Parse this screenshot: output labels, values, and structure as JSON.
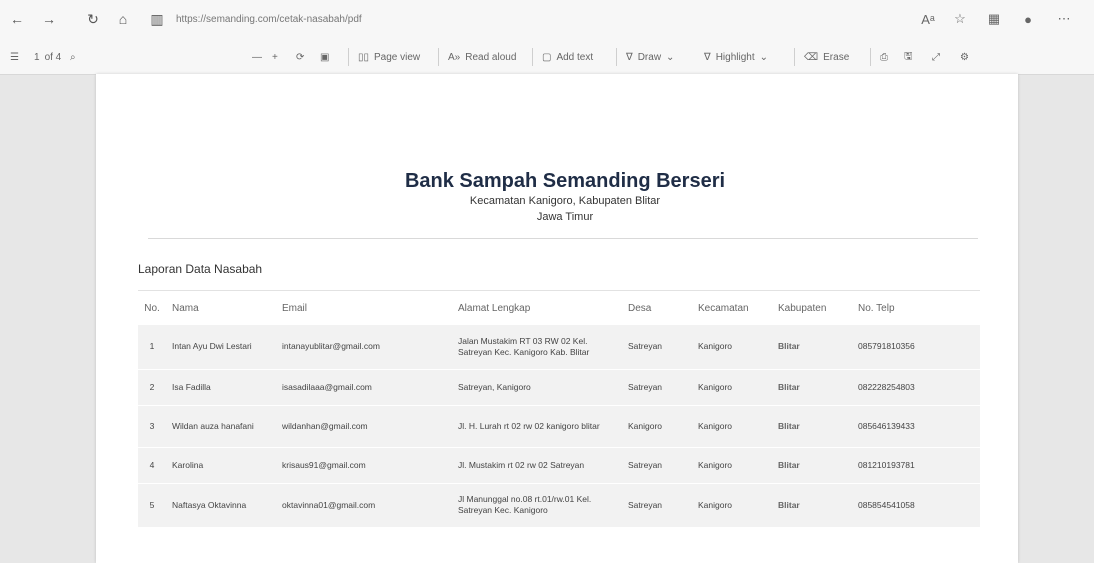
{
  "browser": {
    "url": "https://semanding.com/cetak-nasabah/pdf",
    "icons": [
      "back-icon",
      "forward-icon",
      "refresh-icon",
      "home-icon",
      "site-info-icon",
      "read-aloud-icon",
      "favorite-icon",
      "collections-icon",
      "profile-icon",
      "more-icon"
    ]
  },
  "pdf_toolbar": {
    "page_current": "1",
    "page_total": "of 4",
    "zoom_out": "—",
    "zoom_in": "+",
    "page_view": "Page view",
    "read_aloud": "Read aloud",
    "add_text": "Add text",
    "draw": "Draw",
    "highlight": "Highlight",
    "erase": "Erase"
  },
  "document": {
    "title": "Bank Sampah Semanding Berseri",
    "subtitle": "Kecamatan Kanigoro, Kabupaten Blitar",
    "subtitle2": "Jawa Timur",
    "report_label": "Laporan Data Nasabah",
    "columns": [
      "No.",
      "Nama",
      "Email",
      "Alamat Lengkap",
      "Desa",
      "Kecamatan",
      "Kabupaten",
      "No. Telp"
    ],
    "rows": [
      {
        "no": "1",
        "nama": "Intan Ayu Dwi Lestari",
        "email": "intanayublitar@gmail.com",
        "alamat": "Jalan Mustakim RT 03 RW 02 Kel. Satreyan Kec. Kanigoro Kab. Blitar",
        "desa": "Satreyan",
        "kecamatan": "Kanigoro",
        "kabupaten": "Blitar",
        "telp": "085791810356"
      },
      {
        "no": "2",
        "nama": "Isa Fadilla",
        "email": "isasadilaaa@gmail.com",
        "alamat": "Satreyan, Kanigoro",
        "desa": "Satreyan",
        "kecamatan": "Kanigoro",
        "kabupaten": "Blitar",
        "telp": "082228254803"
      },
      {
        "no": "3",
        "nama": "Wildan auza hanafani",
        "email": "wildanhan@gmail.com",
        "alamat": "Jl. H. Lurah rt 02 rw 02 kanigoro blitar",
        "desa": "Kanigoro",
        "kecamatan": "Kanigoro",
        "kabupaten": "Blitar",
        "telp": "085646139433"
      },
      {
        "no": "4",
        "nama": "Karolina",
        "email": "krisaus91@gmail.com",
        "alamat": "Jl. Mustakim rt 02 rw 02 Satreyan",
        "desa": "Satreyan",
        "kecamatan": "Kanigoro",
        "kabupaten": "Blitar",
        "telp": "081210193781"
      },
      {
        "no": "5",
        "nama": "Naftasya Oktavinna",
        "email": "oktavinna01@gmail.com",
        "alamat": "Jl Manunggal no.08 rt.01/rw.01 Kel. Satreyan Kec. Kanigoro",
        "desa": "Satreyan",
        "kecamatan": "Kanigoro",
        "kabupaten": "Blitar",
        "telp": "085854541058"
      }
    ]
  }
}
